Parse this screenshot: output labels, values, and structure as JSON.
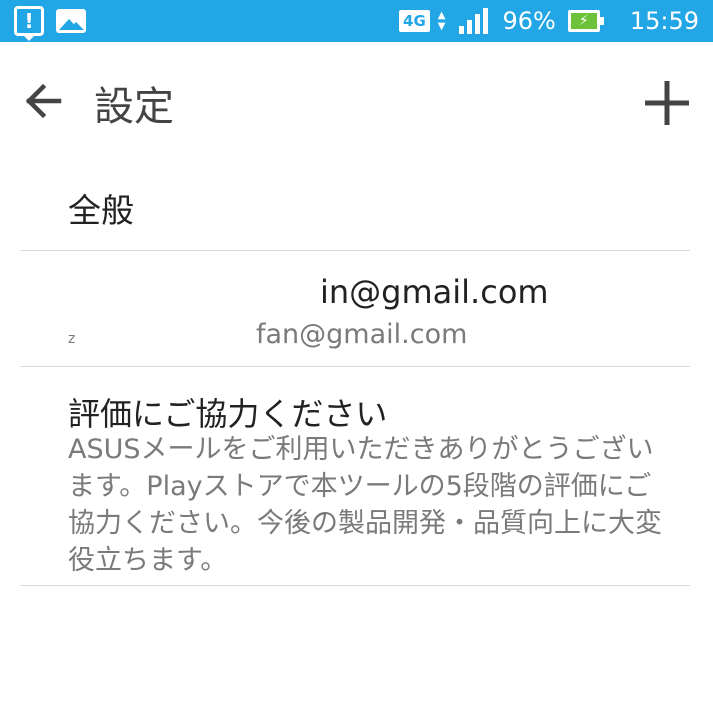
{
  "status_bar": {
    "network": "4G",
    "battery_percent": "96%",
    "time": "15:59",
    "icons": [
      "notification-icon",
      "image-icon",
      "signal-icon",
      "battery-charging-icon"
    ],
    "color": "#22a6e6"
  },
  "toolbar": {
    "title": "設定",
    "back_icon": "arrow-left-icon",
    "add_icon": "plus-icon"
  },
  "settings": {
    "general_label": "全般",
    "account": {
      "title": "in@gmail.com",
      "subtitle": "fan@gmail.com",
      "mark": "z"
    },
    "rate": {
      "title": "評価にご協力ください",
      "description": "ASUSメールをご利用いただきありがとうございます。Playストアで本ツールの5段階の評価にご協力ください。今後の製品開発・品質向上に大変役立ちます。"
    }
  }
}
